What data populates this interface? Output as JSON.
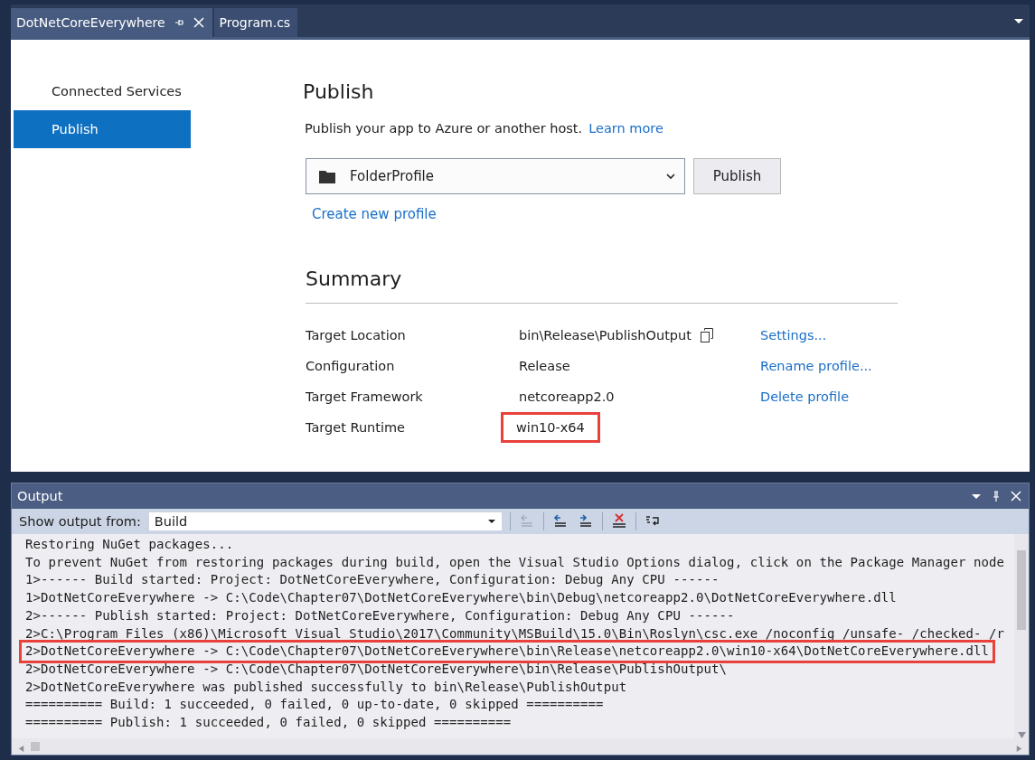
{
  "tabs": [
    {
      "label": "DotNetCoreEverywhere",
      "selected": true,
      "pinnable": true
    },
    {
      "label": "Program.cs",
      "selected": false,
      "pinnable": false
    }
  ],
  "sidebar": {
    "items": [
      {
        "label": "Connected Services",
        "selected": false
      },
      {
        "label": "Publish",
        "selected": true
      }
    ]
  },
  "publish": {
    "title": "Publish",
    "description": "Publish your app to Azure or another host.",
    "learn_more": "Learn more",
    "profile": "FolderProfile",
    "publish_button": "Publish",
    "create_profile": "Create new profile"
  },
  "summary": {
    "title": "Summary",
    "rows": [
      {
        "label": "Target Location",
        "value": "bin\\Release\\PublishOutput",
        "copy": true,
        "action": "Settings...",
        "highlighted": false
      },
      {
        "label": "Configuration",
        "value": "Release",
        "action": "Rename profile...",
        "highlighted": false
      },
      {
        "label": "Target Framework",
        "value": "netcoreapp2.0",
        "action": "Delete profile",
        "highlighted": false
      },
      {
        "label": "Target Runtime",
        "value": "win10-x64",
        "highlighted": true
      }
    ]
  },
  "output": {
    "title": "Output",
    "source_label": "Show output from:",
    "source": "Build",
    "lines": [
      {
        "text": "Restoring NuGet packages...",
        "highlighted": false
      },
      {
        "text": "To prevent NuGet from restoring packages during build, open the Visual Studio Options dialog, click on the Package Manager node",
        "highlighted": false
      },
      {
        "text": "1>------ Build started: Project: DotNetCoreEverywhere, Configuration: Debug Any CPU ------",
        "highlighted": false
      },
      {
        "text": "1>DotNetCoreEverywhere -> C:\\Code\\Chapter07\\DotNetCoreEverywhere\\bin\\Debug\\netcoreapp2.0\\DotNetCoreEverywhere.dll",
        "highlighted": false
      },
      {
        "text": "2>------ Publish started: Project: DotNetCoreEverywhere, Configuration: Debug Any CPU ------",
        "highlighted": false
      },
      {
        "text": "2>C:\\Program Files (x86)\\Microsoft Visual Studio\\2017\\Community\\MSBuild\\15.0\\Bin\\Roslyn\\csc.exe /noconfig /unsafe- /checked- /r",
        "highlighted": false
      },
      {
        "text": "2>DotNetCoreEverywhere -> C:\\Code\\Chapter07\\DotNetCoreEverywhere\\bin\\Release\\netcoreapp2.0\\win10-x64\\DotNetCoreEverywhere.dll",
        "highlighted": true
      },
      {
        "text": "2>DotNetCoreEverywhere -> C:\\Code\\Chapter07\\DotNetCoreEverywhere\\bin\\Release\\PublishOutput\\",
        "highlighted": false
      },
      {
        "text": "2>DotNetCoreEverywhere was published successfully to bin\\Release\\PublishOutput",
        "highlighted": false
      },
      {
        "text": "========== Build: 1 succeeded, 0 failed, 0 up-to-date, 0 skipped ==========",
        "highlighted": false
      },
      {
        "text": "========== Publish: 1 succeeded, 0 failed, 0 skipped ==========",
        "highlighted": false
      }
    ]
  }
}
